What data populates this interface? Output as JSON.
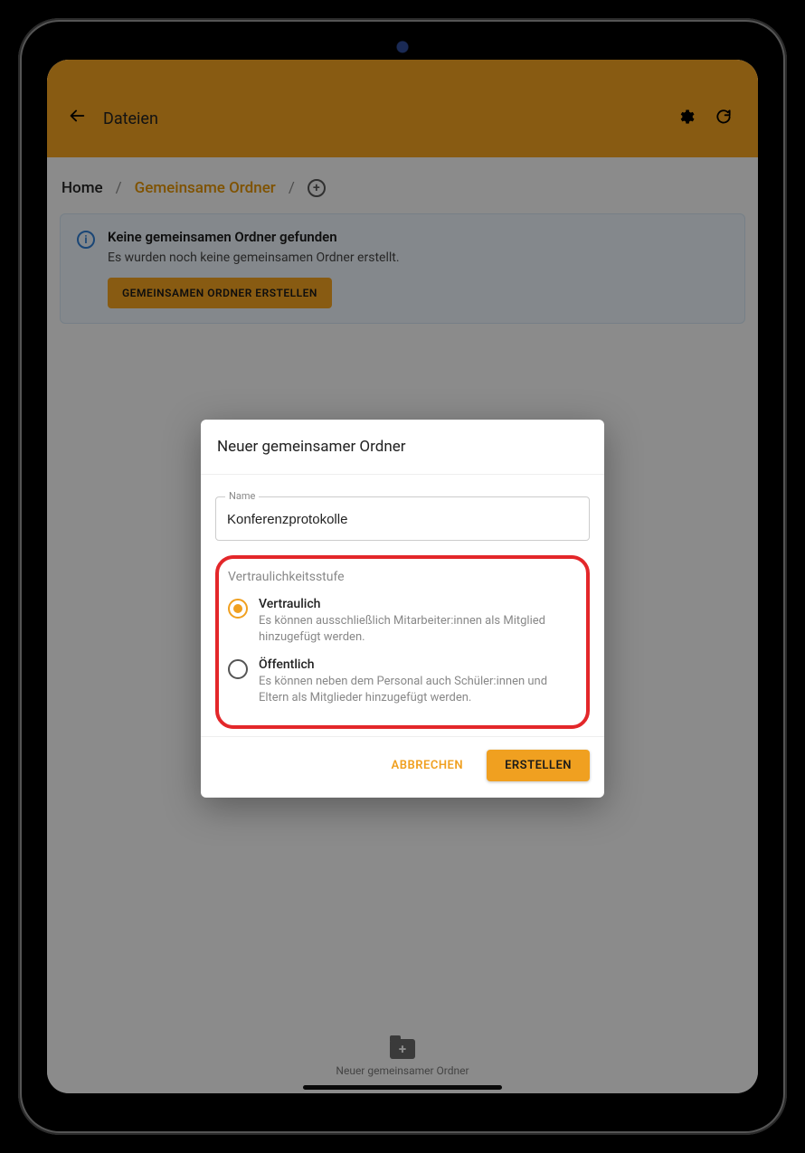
{
  "appbar": {
    "title": "Dateien"
  },
  "breadcrumb": {
    "home": "Home",
    "current": "Gemeinsame Ordner"
  },
  "info": {
    "title": "Keine gemeinsamen Ordner gefunden",
    "text": "Es wurden noch keine gemeinsamen Ordner erstellt.",
    "button": "GEMEINSAMEN ORDNER ERSTELLEN"
  },
  "bottom": {
    "label": "Neuer gemeinsamer Ordner"
  },
  "modal": {
    "title": "Neuer gemeinsamer Ordner",
    "name_label": "Name",
    "name_value": "Konferenzprotokolle",
    "fs_label": "Vertraulichkeitsstufe",
    "options": [
      {
        "title": "Vertraulich",
        "desc": "Es können ausschließlich Mitarbeiter:innen als Mitglied hinzugefügt werden.",
        "checked": true
      },
      {
        "title": "Öffentlich",
        "desc": "Es können neben dem Personal auch Schüler:innen und Eltern als Mitglieder hinzugefügt werden.",
        "checked": false
      }
    ],
    "cancel": "ABBRECHEN",
    "create": "ERSTELLEN"
  }
}
